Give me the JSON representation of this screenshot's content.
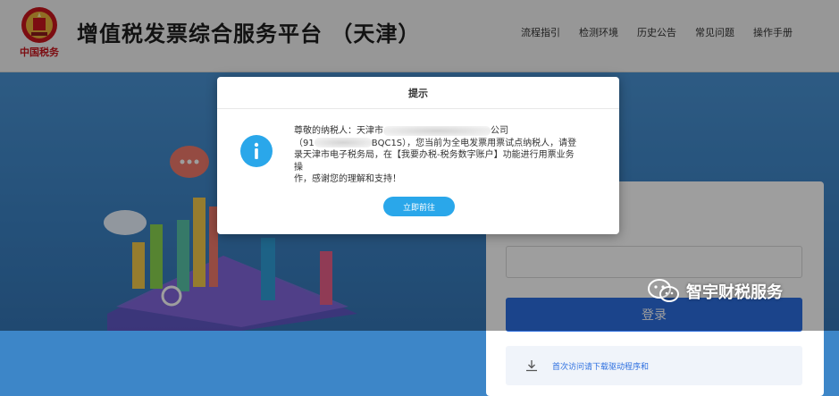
{
  "header": {
    "emblem_caption": "中国税务",
    "title": "增值税发票综合服务平台  （天津）",
    "nav": [
      "流程指引",
      "检测环境",
      "历史公告",
      "常见问题",
      "操作手册"
    ]
  },
  "login": {
    "button_label": "登录",
    "download_text": "首次访问请下载驱动程序和"
  },
  "dialog": {
    "title": "提示",
    "icon": "info-icon",
    "line1_a": "尊敬的纳税人：天津市",
    "line1_b": "公司",
    "line2_a": "（91",
    "line2_b": "BQC1S），您当前为全电发票用票试点纳税人，请登",
    "line3": "录天津市电子税务局，在【我要办税-税务数字账户】功能进行用票业务操",
    "line4": "作，感谢您的理解和支持！",
    "confirm_label": "立即前往"
  },
  "watermark": {
    "text": "智宇财税服务"
  },
  "colors": {
    "accent": "#2aa7ea",
    "login_button": "#2d6fe0",
    "background": "#3d86c8"
  }
}
